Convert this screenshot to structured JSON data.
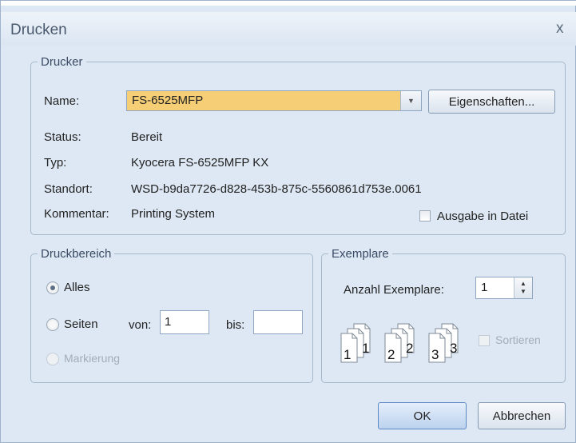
{
  "window": {
    "title": "Drucken",
    "close_glyph": "x"
  },
  "printer_group": {
    "legend": "Drucker",
    "name_label": "Name:",
    "name_value": "FS-6525MFP",
    "properties_button": "Eigenschaften...",
    "status_label": "Status:",
    "status_value": "Bereit",
    "type_label": "Typ:",
    "type_value": "Kyocera FS-6525MFP KX",
    "location_label": "Standort:",
    "location_value": "WSD-b9da7726-d828-453b-875c-5560861d753e.0061",
    "comment_label": "Kommentar:",
    "comment_value": "Printing System",
    "print_to_file_label": "Ausgabe in Datei",
    "print_to_file_checked": false
  },
  "range_group": {
    "legend": "Druckbereich",
    "all_label": "Alles",
    "pages_label": "Seiten",
    "from_label": "von:",
    "from_value": "1",
    "to_label": "bis:",
    "to_value": "",
    "selection_label": "Markierung",
    "selected_option": "Alles"
  },
  "copies_group": {
    "legend": "Exemplare",
    "count_label": "Anzahl Exemplare:",
    "count_value": "1",
    "collate_label": "Sortieren",
    "collate_checked": false,
    "collate_icon_pages": [
      {
        "a": "1",
        "b": "1"
      },
      {
        "a": "2",
        "b": "2"
      },
      {
        "a": "3",
        "b": "3"
      }
    ]
  },
  "buttons": {
    "ok": "OK",
    "cancel": "Abbrechen"
  },
  "colors": {
    "name_combo_highlight": "#f6ce75",
    "dialog_background": "#dde8f4"
  }
}
